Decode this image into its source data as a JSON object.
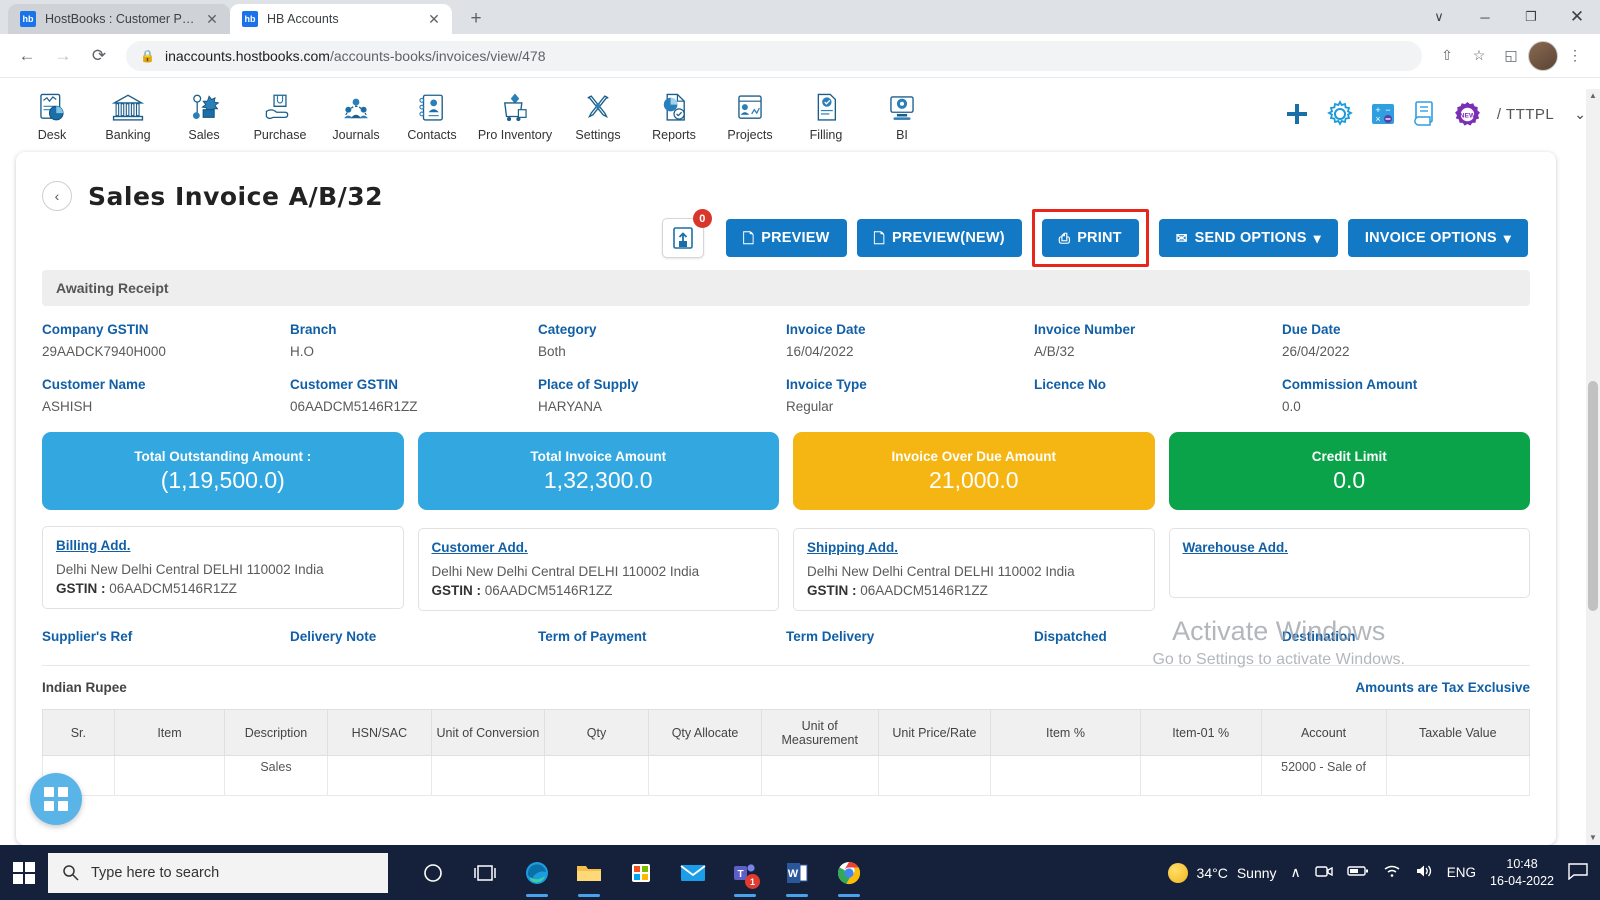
{
  "browser": {
    "tabs": [
      {
        "title": "HostBooks : Customer Portal",
        "favicon_label": "hb",
        "close": "✕",
        "active": false
      },
      {
        "title": "HB Accounts",
        "favicon_label": "hb",
        "close": "✕",
        "active": true
      }
    ],
    "new_tab": "+",
    "window_controls": {
      "minimize": "─",
      "maximize": "❐",
      "close": "✕",
      "expand": "∨"
    },
    "nav": {
      "back": "←",
      "forward": "→",
      "reload": "⟳"
    },
    "address": {
      "lock_icon": "lock-icon",
      "domain": "inaccounts.hostbooks.com",
      "path": "/accounts-books/invoices/view/478",
      "full": "inaccounts.hostbooks.com/accounts-books/invoices/view/478"
    },
    "omni_actions": {
      "share": "⇧",
      "bookmark": "☆",
      "sidepanel": "◱",
      "menu": "⋮"
    }
  },
  "appnav": {
    "items": [
      {
        "label": "Desk",
        "icon": "desk-icon"
      },
      {
        "label": "Banking",
        "icon": "bank-icon"
      },
      {
        "label": "Sales",
        "icon": "sales-icon"
      },
      {
        "label": "Purchase",
        "icon": "purchase-icon"
      },
      {
        "label": "Journals",
        "icon": "journals-icon"
      },
      {
        "label": "Contacts",
        "icon": "contacts-icon"
      },
      {
        "label": "Pro Inventory",
        "icon": "inventory-icon"
      },
      {
        "label": "Settings",
        "icon": "settings-icon"
      },
      {
        "label": "Reports",
        "icon": "reports-icon"
      },
      {
        "label": "Projects",
        "icon": "projects-icon"
      },
      {
        "label": "Filling",
        "icon": "filling-icon"
      },
      {
        "label": "BI",
        "icon": "bi-icon"
      }
    ],
    "right": {
      "add": "plus-icon",
      "settings": "gear-icon",
      "calculator": "calculator-icon",
      "notes": "notes-icon",
      "new_badge": "NEW",
      "org": "/ TTTPL",
      "caret": "⌄"
    }
  },
  "page": {
    "back_icon": "‹",
    "title": "Sales Invoice A/B/32",
    "upload": {
      "icon": "upload-icon",
      "badge": "0"
    },
    "actions": [
      {
        "label": "PREVIEW",
        "icon": "὜B",
        "name": "preview-button",
        "highlighted": false
      },
      {
        "label": "PREVIEW(NEW)",
        "icon": "὜B",
        "name": "preview-new-button",
        "highlighted": false
      },
      {
        "label": "PRINT",
        "icon": "⎙",
        "name": "print-button",
        "highlighted": true
      },
      {
        "label": "SEND OPTIONS",
        "icon": "✉",
        "caret": "▾",
        "name": "send-options-button",
        "highlighted": false
      },
      {
        "label": "INVOICE OPTIONS",
        "icon": "",
        "caret": "▾",
        "name": "invoice-options-button",
        "highlighted": false
      }
    ],
    "status": "Awaiting Receipt",
    "fields_row1": [
      {
        "label": "Company GSTIN",
        "value": "29AADCK7940H000"
      },
      {
        "label": "Branch",
        "value": "H.O"
      },
      {
        "label": "Category",
        "value": "Both"
      },
      {
        "label": "Invoice Date",
        "value": "16/04/2022"
      },
      {
        "label": "Invoice Number",
        "value": "A/B/32"
      },
      {
        "label": "Due Date",
        "value": "26/04/2022"
      }
    ],
    "fields_row2": [
      {
        "label": "Customer Name",
        "value": "ASHISH"
      },
      {
        "label": "Customer GSTIN",
        "value": "06AADCM5146R1ZZ"
      },
      {
        "label": "Place of Supply",
        "value": "HARYANA"
      },
      {
        "label": "Invoice Type",
        "value": "Regular"
      },
      {
        "label": "Licence No",
        "value": ""
      },
      {
        "label": "Commission Amount",
        "value": "0.0"
      }
    ],
    "cards": [
      {
        "title": "Total Outstanding Amount :",
        "value": "(1,19,500.0)",
        "color": "#33a7e0"
      },
      {
        "title": "Total Invoice Amount",
        "value": "1,32,300.0",
        "color": "#33a7e0"
      },
      {
        "title": "Invoice Over Due Amount",
        "value": "21,000.0",
        "color": "#f5b512"
      },
      {
        "title": "Credit Limit",
        "value": "0.0",
        "color": "#0aa34a"
      }
    ],
    "addresses": [
      {
        "title": "Billing Add.",
        "line": "Delhi New Delhi Central DELHI 110002 India",
        "gstin_label": "GSTIN :",
        "gstin": "06AADCM5146R1ZZ"
      },
      {
        "title": "Customer Add.",
        "line": "Delhi New Delhi Central DELHI 110002 India",
        "gstin_label": "GSTIN :",
        "gstin": "06AADCM5146R1ZZ"
      },
      {
        "title": "Shipping Add.",
        "line": "Delhi New Delhi Central DELHI 110002 India",
        "gstin_label": "GSTIN :",
        "gstin": "06AADCM5146R1ZZ"
      },
      {
        "title": "Warehouse Add.",
        "line": "",
        "gstin_label": "",
        "gstin": ""
      }
    ],
    "refs": [
      {
        "label": "Supplier's Ref",
        "value": ""
      },
      {
        "label": "Delivery Note",
        "value": ""
      },
      {
        "label": "Term of Payment",
        "value": ""
      },
      {
        "label": "Term Delivery",
        "value": ""
      },
      {
        "label": "Dispatched",
        "value": ""
      },
      {
        "label": "Destination",
        "value": ""
      }
    ],
    "currency": "Indian Rupee",
    "tax_note": "Amounts are Tax Exclusive",
    "table": {
      "columns": [
        "Sr.",
        "Item",
        "Description",
        "HSN/SAC",
        "Unit of Conversion",
        "Qty",
        "Qty Allocate",
        "Unit of Measurement",
        "Unit Price/Rate",
        "Item %",
        "Item-01 %",
        "Account",
        "Taxable Value"
      ],
      "rows": [
        {
          "sr": "",
          "item": "",
          "description": "Sales",
          "hsn": "",
          "unit_conversion": "",
          "qty": "",
          "qty_allocate": "",
          "unit_measurement": "",
          "unit_price": "",
          "item_pct": "",
          "item01_pct": "",
          "account": "52000 - Sale of",
          "taxable_value": ""
        }
      ]
    },
    "fab": "grid-icon"
  },
  "watermark": {
    "line1": "Activate Windows",
    "line2": "Go to Settings to activate Windows."
  },
  "taskbar": {
    "start": "windows-start-icon",
    "search_placeholder": "Type here to search",
    "icons": [
      {
        "name": "cortana-icon",
        "glyph": "◯"
      },
      {
        "name": "task-view-icon",
        "glyph": "⌸"
      },
      {
        "name": "edge-icon",
        "glyph": ""
      },
      {
        "name": "file-explorer-icon",
        "glyph": ""
      },
      {
        "name": "microsoft-store-icon",
        "glyph": ""
      },
      {
        "name": "mail-icon",
        "glyph": ""
      },
      {
        "name": "teams-icon",
        "glyph": "T",
        "badge": "1"
      },
      {
        "name": "word-icon",
        "glyph": "W"
      },
      {
        "name": "chrome-icon",
        "glyph": ""
      }
    ],
    "tray": {
      "weather_temp": "34°C",
      "weather_desc": "Sunny",
      "chevron": "∧",
      "camera": "camera-icon",
      "battery": "battery-icon",
      "wifi": "wifi-icon",
      "volume": "volume-icon",
      "language": "ENG",
      "time": "10:48",
      "date": "16-04-2022",
      "action_center": "notification-icon"
    }
  },
  "colors": {
    "primary_blue": "#1379c4",
    "label_blue": "#115fa6",
    "highlight_red": "#e8271c",
    "card_blue": "#33a7e0",
    "card_yellow": "#f5b512",
    "card_green": "#0aa34a"
  }
}
